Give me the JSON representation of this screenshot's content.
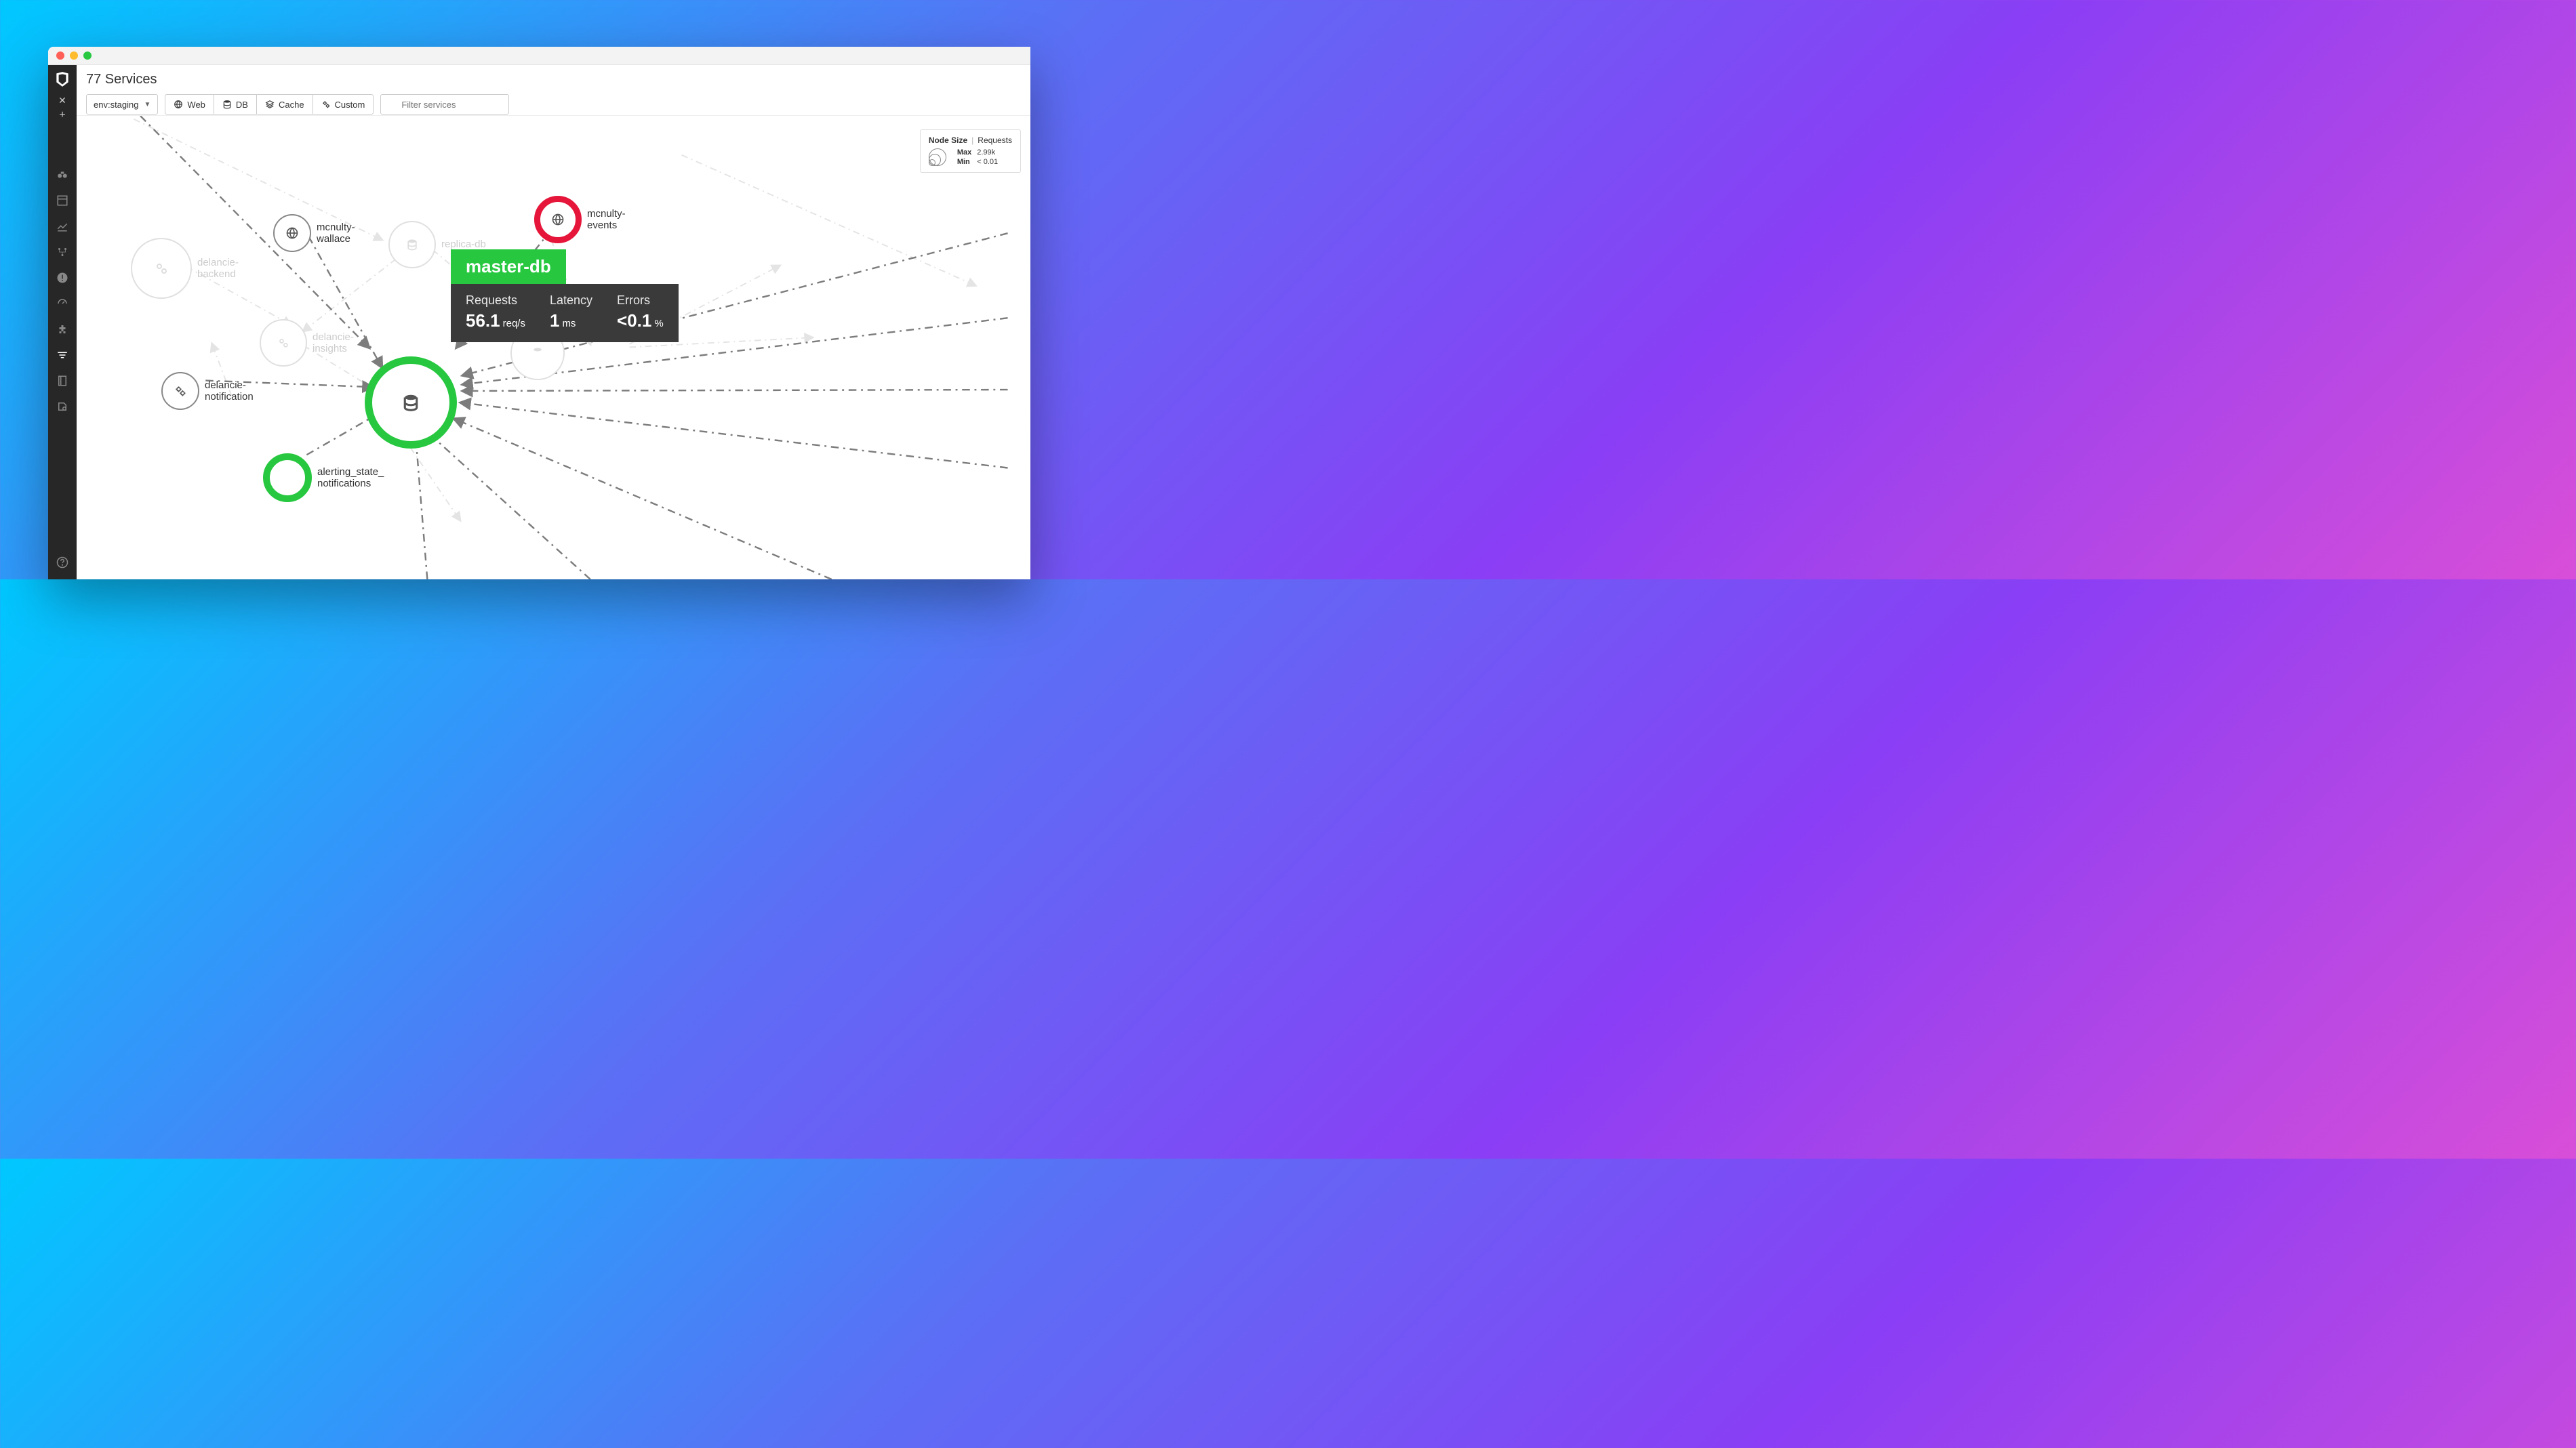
{
  "page": {
    "title": "77 Services"
  },
  "env": {
    "label": "env:staging"
  },
  "pills": {
    "web": "Web",
    "db": "DB",
    "cache": "Cache",
    "custom": "Custom"
  },
  "search": {
    "placeholder": "Filter services"
  },
  "legend": {
    "title": "Node Size",
    "metric": "Requests",
    "max_label": "Max",
    "max_value": "2.99k",
    "min_label": "Min",
    "min_value": "< 0.01"
  },
  "tooltip": {
    "name": "master-db",
    "requests_label": "Requests",
    "requests_value": "56.1",
    "requests_unit": "req/s",
    "latency_label": "Latency",
    "latency_value": "1",
    "latency_unit": "ms",
    "errors_label": "Errors",
    "errors_value": "<0.1",
    "errors_unit": "%"
  },
  "nodes": {
    "mcnulty_wallace": "mcnulty-\nwallace",
    "mcnulty_events": "mcnulty-\nevents",
    "delancie_notification": "delancie-\nnotification",
    "alerting_state_notifications": "alerting_state_\nnotifications",
    "delancie_backend": "delancie-\nbackend",
    "replica_db": "replica-db",
    "delancie_insights": "delancie-\ninsights"
  },
  "colors": {
    "green": "#27c840",
    "red": "#e6163a",
    "gray_edge": "#7c7c7c",
    "faded_edge": "#e4e4e4"
  }
}
